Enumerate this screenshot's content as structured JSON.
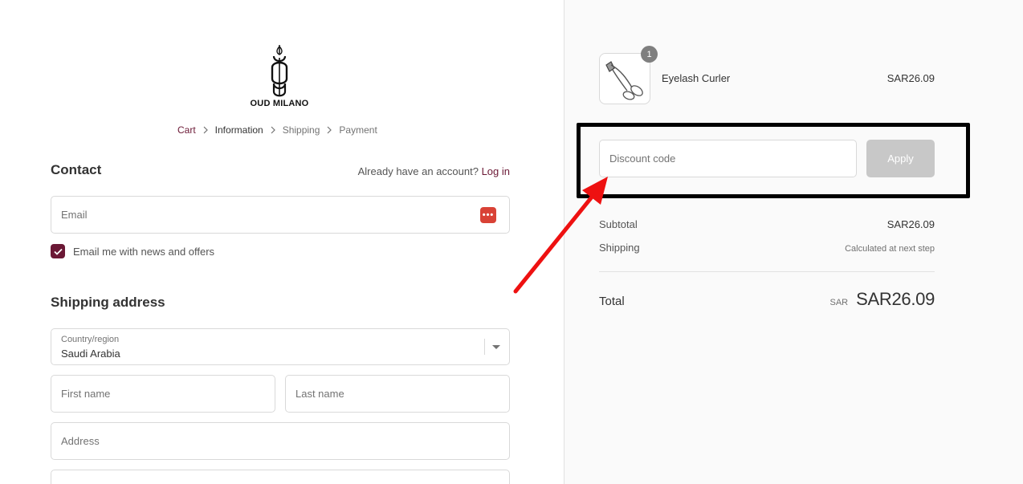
{
  "brand": {
    "name": "OUD MILANO"
  },
  "breadcrumb": [
    {
      "label": "Cart"
    },
    {
      "label": "Information"
    },
    {
      "label": "Shipping"
    },
    {
      "label": "Payment"
    }
  ],
  "contact": {
    "title": "Contact",
    "account_prompt": "Already have an account?",
    "login_label": "Log in",
    "email_placeholder": "Email",
    "newsletter_label": "Email me with news and offers",
    "newsletter_checked": true
  },
  "shipping": {
    "title": "Shipping address",
    "country_label": "Country/region",
    "country_value": "Saudi Arabia",
    "first_name_placeholder": "First name",
    "last_name_placeholder": "Last name",
    "address_placeholder": "Address"
  },
  "order": {
    "item": {
      "name": "Eyelash Curler",
      "price": "SAR26.09",
      "quantity": "1"
    },
    "discount_placeholder": "Discount code",
    "apply_label": "Apply",
    "subtotal_label": "Subtotal",
    "subtotal_value": "SAR26.09",
    "shipping_label": "Shipping",
    "shipping_value": "Calculated at next step",
    "total_label": "Total",
    "total_currency": "SAR",
    "total_value": "SAR26.09"
  },
  "colors": {
    "accent": "#6b1835",
    "annotation_arrow": "#ee1111",
    "annotation_box": "#000000",
    "apply_disabled": "#c8c8c8"
  }
}
